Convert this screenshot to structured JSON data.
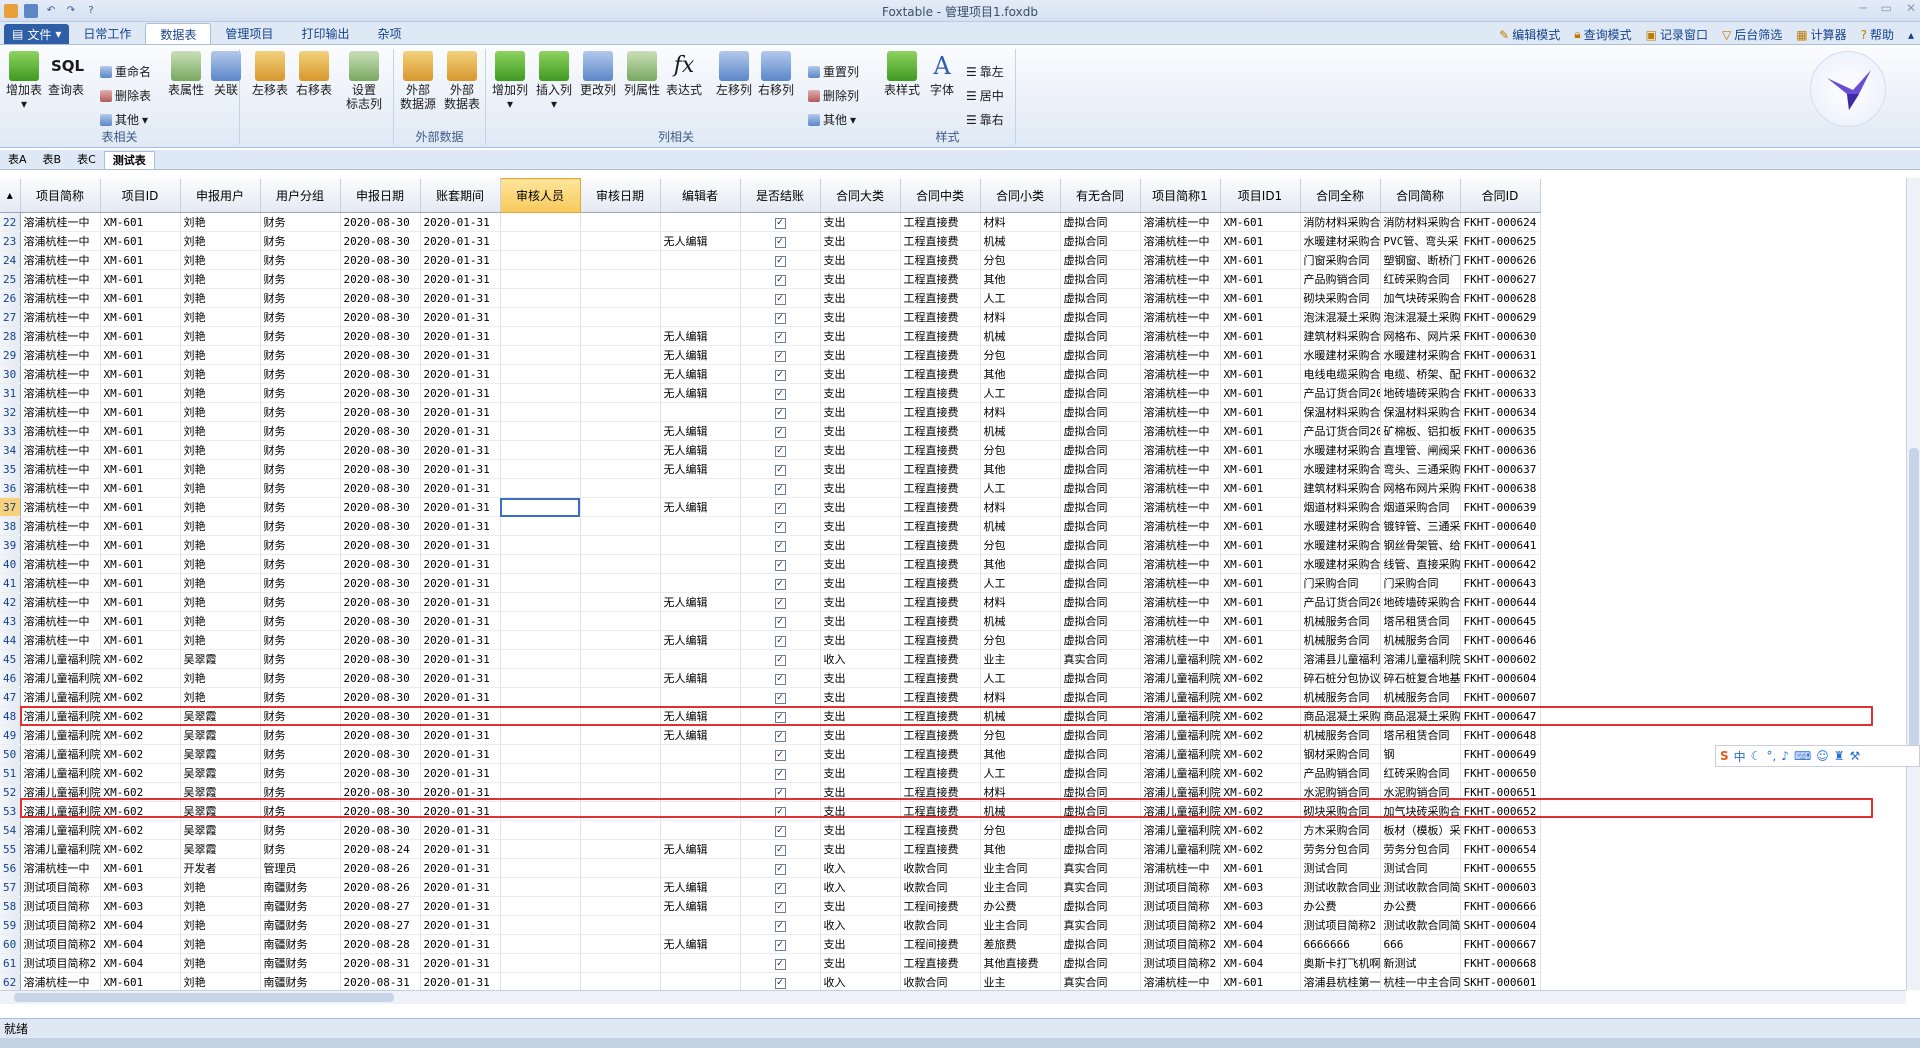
{
  "window": {
    "title": "Foxtable - 管理项目1.foxdb"
  },
  "menubar": {
    "file": "文件",
    "tabs": [
      "日常工作",
      "数据表",
      "管理项目",
      "打印输出",
      "杂项"
    ],
    "right": [
      "编辑模式",
      "查询模式",
      "记录窗口",
      "后台筛选",
      "计算器",
      "帮助"
    ]
  },
  "ribbon": {
    "g1": {
      "label": "表相关",
      "b1": "增加表",
      "b2": "查询表",
      "s1": "重命名",
      "s2": "删除表",
      "s3": "其他",
      "b3": "表属性",
      "b4": "关联",
      "b5": "左移表",
      "b6": "右移表",
      "b7a": "设置",
      "b7b": "标志列"
    },
    "g2": {
      "label": "外部数据",
      "b1a": "外部",
      "b1b": "数据源",
      "b2a": "外部",
      "b2b": "数据表"
    },
    "g3": {
      "label": "列相关",
      "b1": "增加列",
      "b2": "插入列",
      "b3": "更改列",
      "b4": "列属性",
      "b5": "表达式",
      "b6": "左移列",
      "b7": "右移列",
      "s1": "重置列",
      "s2": "删除列",
      "s3": "其他"
    },
    "g4": {
      "label": "样式",
      "b1": "表样式",
      "b2": "字体",
      "s1": "靠左",
      "s2": "居中",
      "s3": "靠右"
    }
  },
  "sheets": [
    "表A",
    "表B",
    "表C",
    "测试表"
  ],
  "grid": {
    "columns": [
      "项目简称",
      "项目ID",
      "申报用户",
      "用户分组",
      "申报日期",
      "账套期间",
      "审核人员",
      "审核日期",
      "编辑者",
      "是否结账",
      "合同大类",
      "合同中类",
      "合同小类",
      "有无合同",
      "项目简称1",
      "项目ID1",
      "合同全称",
      "合同简称",
      "合同ID"
    ],
    "rows": [
      [
        "22",
        "溶浦杭桂一中",
        "XM-601",
        "刘艳",
        "财务",
        "2020-08-30",
        "2020-01-31",
        "",
        "",
        "",
        "✓",
        "支出",
        "工程直接费",
        "材料",
        "虚拟合同",
        "溶浦杭桂一中",
        "XM-601",
        "消防材料采购合",
        "消防材料采购合",
        "FKHT-000624"
      ],
      [
        "23",
        "溶浦杭桂一中",
        "XM-601",
        "刘艳",
        "财务",
        "2020-08-30",
        "2020-01-31",
        "",
        "",
        "无人编辑",
        "✓",
        "支出",
        "工程直接费",
        "机械",
        "虚拟合同",
        "溶浦杭桂一中",
        "XM-601",
        "水暖建材采购合",
        "PVC管、弯头采",
        "FKHT-000625"
      ],
      [
        "24",
        "溶浦杭桂一中",
        "XM-601",
        "刘艳",
        "财务",
        "2020-08-30",
        "2020-01-31",
        "",
        "",
        "",
        "✓",
        "支出",
        "工程直接费",
        "分包",
        "虚拟合同",
        "溶浦杭桂一中",
        "XM-601",
        "门窗采购合同",
        "塑钢窗、断桥门",
        "FKHT-000626"
      ],
      [
        "25",
        "溶浦杭桂一中",
        "XM-601",
        "刘艳",
        "财务",
        "2020-08-30",
        "2020-01-31",
        "",
        "",
        "",
        "✓",
        "支出",
        "工程直接费",
        "其他",
        "虚拟合同",
        "溶浦杭桂一中",
        "XM-601",
        "产品购销合同",
        "红砖采购合同",
        "FKHT-000627"
      ],
      [
        "26",
        "溶浦杭桂一中",
        "XM-601",
        "刘艳",
        "财务",
        "2020-08-30",
        "2020-01-31",
        "",
        "",
        "",
        "✓",
        "支出",
        "工程直接费",
        "人工",
        "虚拟合同",
        "溶浦杭桂一中",
        "XM-601",
        "砌块采购合同",
        "加气块砖采购合",
        "FKHT-000628"
      ],
      [
        "27",
        "溶浦杭桂一中",
        "XM-601",
        "刘艳",
        "财务",
        "2020-08-30",
        "2020-01-31",
        "",
        "",
        "",
        "✓",
        "支出",
        "工程直接费",
        "材料",
        "虚拟合同",
        "溶浦杭桂一中",
        "XM-601",
        "泡沫混凝土采购",
        "泡沫混凝土采购",
        "FKHT-000629"
      ],
      [
        "28",
        "溶浦杭桂一中",
        "XM-601",
        "刘艳",
        "财务",
        "2020-08-30",
        "2020-01-31",
        "",
        "",
        "无人编辑",
        "✓",
        "支出",
        "工程直接费",
        "机械",
        "虚拟合同",
        "溶浦杭桂一中",
        "XM-601",
        "建筑材料采购合",
        "网格布、网片采",
        "FKHT-000630"
      ],
      [
        "29",
        "溶浦杭桂一中",
        "XM-601",
        "刘艳",
        "财务",
        "2020-08-30",
        "2020-01-31",
        "",
        "",
        "无人编辑",
        "✓",
        "支出",
        "工程直接费",
        "分包",
        "虚拟合同",
        "溶浦杭桂一中",
        "XM-601",
        "水暖建材采购合",
        "水暖建材采购合",
        "FKHT-000631"
      ],
      [
        "30",
        "溶浦杭桂一中",
        "XM-601",
        "刘艳",
        "财务",
        "2020-08-30",
        "2020-01-31",
        "",
        "",
        "无人编辑",
        "✓",
        "支出",
        "工程直接费",
        "其他",
        "虚拟合同",
        "溶浦杭桂一中",
        "XM-601",
        "电线电缆采购合",
        "电缆、桥架、配",
        "FKHT-000632"
      ],
      [
        "31",
        "溶浦杭桂一中",
        "XM-601",
        "刘艳",
        "财务",
        "2020-08-30",
        "2020-01-31",
        "",
        "",
        "无人编辑",
        "✓",
        "支出",
        "工程直接费",
        "人工",
        "虚拟合同",
        "溶浦杭桂一中",
        "XM-601",
        "产品订货合同20",
        "地砖墙砖采购合",
        "FKHT-000633"
      ],
      [
        "32",
        "溶浦杭桂一中",
        "XM-601",
        "刘艳",
        "财务",
        "2020-08-30",
        "2020-01-31",
        "",
        "",
        "",
        "✓",
        "支出",
        "工程直接费",
        "材料",
        "虚拟合同",
        "溶浦杭桂一中",
        "XM-601",
        "保温材料采购合",
        "保温材料采购合",
        "FKHT-000634"
      ],
      [
        "33",
        "溶浦杭桂一中",
        "XM-601",
        "刘艳",
        "财务",
        "2020-08-30",
        "2020-01-31",
        "",
        "",
        "无人编辑",
        "✓",
        "支出",
        "工程直接费",
        "机械",
        "虚拟合同",
        "溶浦杭桂一中",
        "XM-601",
        "产品订货合同20",
        "矿棉板、铝扣板",
        "FKHT-000635"
      ],
      [
        "34",
        "溶浦杭桂一中",
        "XM-601",
        "刘艳",
        "财务",
        "2020-08-30",
        "2020-01-31",
        "",
        "",
        "无人编辑",
        "✓",
        "支出",
        "工程直接费",
        "分包",
        "虚拟合同",
        "溶浦杭桂一中",
        "XM-601",
        "水暖建材采购合",
        "直埋管、闸阀采",
        "FKHT-000636"
      ],
      [
        "35",
        "溶浦杭桂一中",
        "XM-601",
        "刘艳",
        "财务",
        "2020-08-30",
        "2020-01-31",
        "",
        "",
        "无人编辑",
        "✓",
        "支出",
        "工程直接费",
        "其他",
        "虚拟合同",
        "溶浦杭桂一中",
        "XM-601",
        "水暖建材采购合",
        "弯头、三通采购",
        "FKHT-000637"
      ],
      [
        "36",
        "溶浦杭桂一中",
        "XM-601",
        "刘艳",
        "财务",
        "2020-08-30",
        "2020-01-31",
        "",
        "",
        "",
        "✓",
        "支出",
        "工程直接费",
        "人工",
        "虚拟合同",
        "溶浦杭桂一中",
        "XM-601",
        "建筑材料采购合",
        "网格布网片采购",
        "FKHT-000638"
      ],
      [
        "37",
        "溶浦杭桂一中",
        "XM-601",
        "刘艳",
        "财务",
        "2020-08-30",
        "2020-01-31",
        "",
        "",
        "无人编辑",
        "✓",
        "支出",
        "工程直接费",
        "材料",
        "虚拟合同",
        "溶浦杭桂一中",
        "XM-601",
        "烟道材料采购合",
        "烟道采购合同",
        "FKHT-000639"
      ],
      [
        "38",
        "溶浦杭桂一中",
        "XM-601",
        "刘艳",
        "财务",
        "2020-08-30",
        "2020-01-31",
        "",
        "",
        "",
        "✓",
        "支出",
        "工程直接费",
        "机械",
        "虚拟合同",
        "溶浦杭桂一中",
        "XM-601",
        "水暖建材采购合",
        "镀锌管、三通采",
        "FKHT-000640"
      ],
      [
        "39",
        "溶浦杭桂一中",
        "XM-601",
        "刘艳",
        "财务",
        "2020-08-30",
        "2020-01-31",
        "",
        "",
        "",
        "✓",
        "支出",
        "工程直接费",
        "分包",
        "虚拟合同",
        "溶浦杭桂一中",
        "XM-601",
        "水暖建材采购合",
        "钢丝骨架管、给",
        "FKHT-000641"
      ],
      [
        "40",
        "溶浦杭桂一中",
        "XM-601",
        "刘艳",
        "财务",
        "2020-08-30",
        "2020-01-31",
        "",
        "",
        "",
        "✓",
        "支出",
        "工程直接费",
        "其他",
        "虚拟合同",
        "溶浦杭桂一中",
        "XM-601",
        "水暖建材采购合",
        "线管、直接采购",
        "FKHT-000642"
      ],
      [
        "41",
        "溶浦杭桂一中",
        "XM-601",
        "刘艳",
        "财务",
        "2020-08-30",
        "2020-01-31",
        "",
        "",
        "",
        "✓",
        "支出",
        "工程直接费",
        "人工",
        "虚拟合同",
        "溶浦杭桂一中",
        "XM-601",
        "门采购合同",
        "门采购合同",
        "FKHT-000643"
      ],
      [
        "42",
        "溶浦杭桂一中",
        "XM-601",
        "刘艳",
        "财务",
        "2020-08-30",
        "2020-01-31",
        "",
        "",
        "无人编辑",
        "✓",
        "支出",
        "工程直接费",
        "材料",
        "虚拟合同",
        "溶浦杭桂一中",
        "XM-601",
        "产品订货合同20",
        "地砖墙砖采购合",
        "FKHT-000644"
      ],
      [
        "43",
        "溶浦杭桂一中",
        "XM-601",
        "刘艳",
        "财务",
        "2020-08-30",
        "2020-01-31",
        "",
        "",
        "",
        "✓",
        "支出",
        "工程直接费",
        "机械",
        "虚拟合同",
        "溶浦杭桂一中",
        "XM-601",
        "机械服务合同",
        "塔吊租赁合同",
        "FKHT-000645"
      ],
      [
        "44",
        "溶浦杭桂一中",
        "XM-601",
        "刘艳",
        "财务",
        "2020-08-30",
        "2020-01-31",
        "",
        "",
        "无人编辑",
        "✓",
        "支出",
        "工程直接费",
        "分包",
        "虚拟合同",
        "溶浦杭桂一中",
        "XM-601",
        "机械服务合同",
        "机械服务合同",
        "FKHT-000646"
      ],
      [
        "45",
        "溶浦儿童福利院",
        "XM-602",
        "吴翠霞",
        "财务",
        "2020-08-30",
        "2020-01-31",
        "",
        "",
        "",
        "✓",
        "收入",
        "工程直接费",
        "业主",
        "真实合同",
        "溶浦儿童福利院",
        "XM-602",
        "溶浦县儿童福利",
        "溶浦儿童福利院",
        "SKHT-000602"
      ],
      [
        "46",
        "溶浦儿童福利院",
        "XM-602",
        "刘艳",
        "财务",
        "2020-08-30",
        "2020-01-31",
        "",
        "",
        "无人编辑",
        "✓",
        "支出",
        "工程直接费",
        "人工",
        "虚拟合同",
        "溶浦儿童福利院",
        "XM-602",
        "碎石桩分包协议",
        "碎石桩复合地基",
        "FKHT-000604"
      ],
      [
        "47",
        "溶浦儿童福利院",
        "XM-602",
        "刘艳",
        "财务",
        "2020-08-30",
        "2020-01-31",
        "",
        "",
        "",
        "✓",
        "支出",
        "工程直接费",
        "材料",
        "虚拟合同",
        "溶浦儿童福利院",
        "XM-602",
        "机械服务合同",
        "机械服务合同",
        "FKHT-000607"
      ],
      [
        "48",
        "溶浦儿童福利院",
        "XM-602",
        "吴翠霞",
        "财务",
        "2020-08-30",
        "2020-01-31",
        "",
        "",
        "无人编辑",
        "✓",
        "支出",
        "工程直接费",
        "机械",
        "虚拟合同",
        "溶浦儿童福利院",
        "XM-602",
        "商品混凝土采购",
        "商品混凝土采购",
        "FKHT-000647"
      ],
      [
        "49",
        "溶浦儿童福利院",
        "XM-602",
        "吴翠霞",
        "财务",
        "2020-08-30",
        "2020-01-31",
        "",
        "",
        "无人编辑",
        "✓",
        "支出",
        "工程直接费",
        "分包",
        "虚拟合同",
        "溶浦儿童福利院",
        "XM-602",
        "机械服务合同",
        "塔吊租赁合同",
        "FKHT-000648"
      ],
      [
        "50",
        "溶浦儿童福利院",
        "XM-602",
        "吴翠霞",
        "财务",
        "2020-08-30",
        "2020-01-31",
        "",
        "",
        "",
        "✓",
        "支出",
        "工程直接费",
        "其他",
        "虚拟合同",
        "溶浦儿童福利院",
        "XM-602",
        "钢材采购合同",
        "钢",
        "FKHT-000649"
      ],
      [
        "51",
        "溶浦儿童福利院",
        "XM-602",
        "吴翠霞",
        "财务",
        "2020-08-30",
        "2020-01-31",
        "",
        "",
        "",
        "✓",
        "支出",
        "工程直接费",
        "人工",
        "虚拟合同",
        "溶浦儿童福利院",
        "XM-602",
        "产品购销合同",
        "红砖采购合同",
        "FKHT-000650"
      ],
      [
        "52",
        "溶浦儿童福利院",
        "XM-602",
        "吴翠霞",
        "财务",
        "2020-08-30",
        "2020-01-31",
        "",
        "",
        "",
        "✓",
        "支出",
        "工程直接费",
        "材料",
        "虚拟合同",
        "溶浦儿童福利院",
        "XM-602",
        "水泥购销合同",
        "水泥购销合同",
        "FKHT-000651"
      ],
      [
        "53",
        "溶浦儿童福利院",
        "XM-602",
        "吴翠霞",
        "财务",
        "2020-08-30",
        "2020-01-31",
        "",
        "",
        "",
        "✓",
        "支出",
        "工程直接费",
        "机械",
        "虚拟合同",
        "溶浦儿童福利院",
        "XM-602",
        "砌块采购合同",
        "加气块砖采购合",
        "FKHT-000652"
      ],
      [
        "54",
        "溶浦儿童福利院",
        "XM-602",
        "吴翠霞",
        "财务",
        "2020-08-30",
        "2020-01-31",
        "",
        "",
        "",
        "✓",
        "支出",
        "工程直接费",
        "分包",
        "虚拟合同",
        "溶浦儿童福利院",
        "XM-602",
        "方木采购合同",
        "板材（模板）采",
        "FKHT-000653"
      ],
      [
        "55",
        "溶浦儿童福利院",
        "XM-602",
        "吴翠霞",
        "财务",
        "2020-08-24",
        "2020-01-31",
        "",
        "",
        "无人编辑",
        "✓",
        "支出",
        "工程直接费",
        "其他",
        "虚拟合同",
        "溶浦儿童福利院",
        "XM-602",
        "劳务分包合同",
        "劳务分包合同",
        "FKHT-000654"
      ],
      [
        "56",
        "溶浦杭桂一中",
        "XM-601",
        "开发者",
        "管理员",
        "2020-08-26",
        "2020-01-31",
        "",
        "",
        "",
        "✓",
        "收入",
        "收款合同",
        "业主合同",
        "真实合同",
        "溶浦杭桂一中",
        "XM-601",
        "测试合同",
        "测试合同",
        "FKHT-000655"
      ],
      [
        "57",
        "测试项目简称",
        "XM-603",
        "刘艳",
        "南疆财务",
        "2020-08-26",
        "2020-01-31",
        "",
        "",
        "无人编辑",
        "✓",
        "收入",
        "收款合同",
        "业主合同",
        "真实合同",
        "测试项目简称",
        "XM-603",
        "测试收款合同业",
        "测试收款合同简",
        "SKHT-000603"
      ],
      [
        "58",
        "测试项目简称",
        "XM-603",
        "刘艳",
        "南疆财务",
        "2020-08-27",
        "2020-01-31",
        "",
        "",
        "无人编辑",
        "✓",
        "支出",
        "工程间接费",
        "办公费",
        "虚拟合同",
        "测试项目简称",
        "XM-603",
        "办公费",
        "办公费",
        "FKHT-000666"
      ],
      [
        "59",
        "测试项目简称2",
        "XM-604",
        "刘艳",
        "南疆财务",
        "2020-08-27",
        "2020-01-31",
        "",
        "",
        "",
        "✓",
        "收入",
        "收款合同",
        "业主合同",
        "真实合同",
        "测试项目简称2",
        "XM-604",
        "测试项目简称2",
        "测试收款合同简",
        "SKHT-000604"
      ],
      [
        "60",
        "测试项目简称2",
        "XM-604",
        "刘艳",
        "南疆财务",
        "2020-08-28",
        "2020-01-31",
        "",
        "",
        "无人编辑",
        "✓",
        "支出",
        "工程间接费",
        "差旅费",
        "虚拟合同",
        "测试项目简称2",
        "XM-604",
        "6666666",
        "666",
        "FKHT-000667"
      ],
      [
        "61",
        "测试项目简称2",
        "XM-604",
        "刘艳",
        "南疆财务",
        "2020-08-31",
        "2020-01-31",
        "",
        "",
        "",
        "✓",
        "支出",
        "工程直接费",
        "其他直接费",
        "虚拟合同",
        "测试项目简称2",
        "XM-604",
        "奥斯卡打飞机啊",
        "新测试",
        "FKHT-000668"
      ],
      [
        "62",
        "溶浦杭桂一中",
        "XM-601",
        "刘艳",
        "南疆财务",
        "2020-08-31",
        "2020-01-31",
        "",
        "",
        "",
        "✓",
        "收入",
        "收款合同",
        "业主",
        "真实合同",
        "溶浦杭桂一中",
        "XM-601",
        "溶浦县杭桂第一",
        "杭桂一中主合同",
        "SKHT-000601"
      ]
    ]
  },
  "status": {
    "text": "就绪"
  },
  "ime": {
    "label": "中"
  }
}
